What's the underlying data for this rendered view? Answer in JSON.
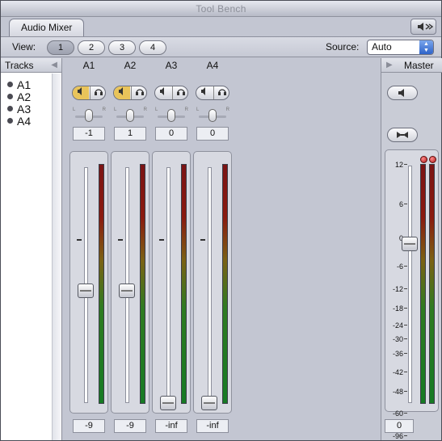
{
  "window": {
    "title": "Tool Bench"
  },
  "tab": {
    "label": "Audio Mixer"
  },
  "toolbar": {
    "view_label": "View:",
    "view_buttons": [
      "1",
      "2",
      "3",
      "4"
    ],
    "source_label": "Source:",
    "source_value": "Auto"
  },
  "tracks": {
    "header": "Tracks",
    "items": [
      "A1",
      "A2",
      "A3",
      "A4"
    ]
  },
  "strips": [
    {
      "name": "A1",
      "pan": "-1",
      "volume": "-9",
      "fader_level": 0.49,
      "mute_on": true
    },
    {
      "name": "A2",
      "pan": "1",
      "volume": "-9",
      "fader_level": 0.49,
      "mute_on": true
    },
    {
      "name": "A3",
      "pan": "0",
      "volume": "-inf",
      "fader_level": 0.0,
      "mute_on": false
    },
    {
      "name": "A4",
      "pan": "0",
      "volume": "-inf",
      "fader_level": 0.0,
      "mute_on": false
    }
  ],
  "master": {
    "header": "Master",
    "scale": [
      "12",
      "6",
      "0",
      "-6",
      "-12",
      "-18",
      "-24",
      "-30",
      "-36",
      "-42",
      "-48",
      "-60",
      "-96"
    ],
    "value": "0",
    "fader_level": 0.69
  }
}
